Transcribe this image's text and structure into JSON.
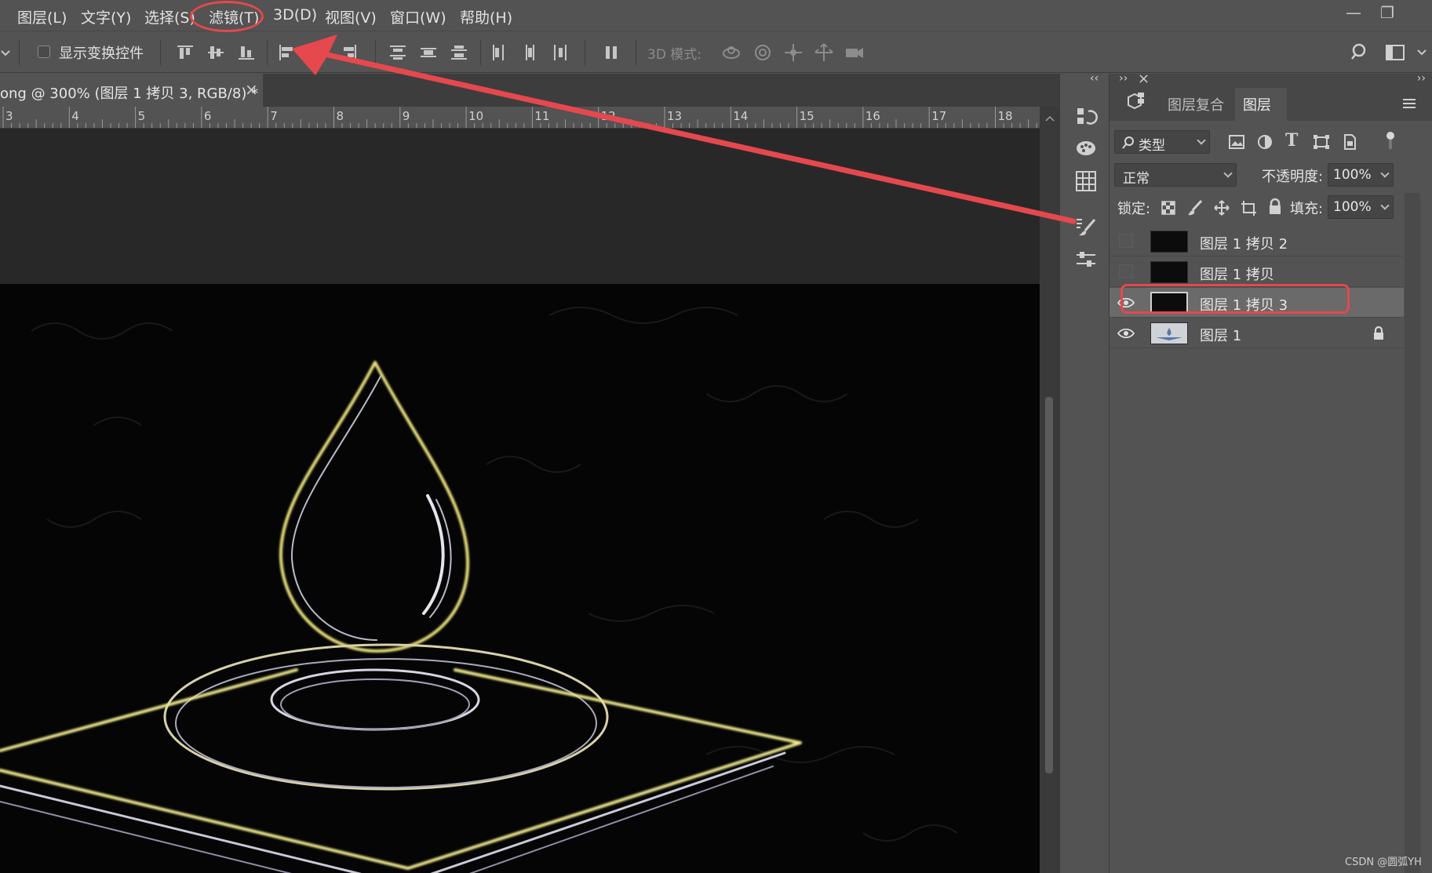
{
  "menu": {
    "items": [
      "图层(L)",
      "文字(Y)",
      "选择(S)",
      "滤镜(T)",
      "3D(D)",
      "视图(V)",
      "窗口(W)",
      "帮助(H)"
    ],
    "highlighted": "滤镜(T)"
  },
  "window_controls": {
    "minimize": "—",
    "restore": "❐"
  },
  "options_bar": {
    "show_transform_label": "显示变换控件",
    "show_transform_checked": false,
    "mode_3d_label": "3D 模式:"
  },
  "document": {
    "tab_title": "ong @ 300% (图层 1 拷贝 3, RGB/8) *",
    "close": "×"
  },
  "ruler": {
    "ticks": [
      "3",
      "4",
      "5",
      "6",
      "7",
      "8",
      "9",
      "10",
      "11",
      "12",
      "13",
      "14",
      "15",
      "16",
      "17",
      "18"
    ]
  },
  "dock": {
    "collapse_left": "‹‹",
    "collapse_right": "››",
    "close": "×"
  },
  "layers_panel": {
    "tabs": [
      "图层复合",
      "图层"
    ],
    "active_tab": "图层",
    "filter_kind": "类型",
    "blend_mode": "正常",
    "opacity_label": "不透明度:",
    "opacity_value": "100%",
    "lock_label": "锁定:",
    "fill_label": "填充:",
    "fill_value": "100%",
    "layers": [
      {
        "name": "图层 1 拷贝 2",
        "visible": false,
        "selected": false,
        "locked": false
      },
      {
        "name": "图层 1 拷贝",
        "visible": false,
        "selected": false,
        "locked": false
      },
      {
        "name": "图层 1 拷贝 3",
        "visible": true,
        "selected": true,
        "locked": false
      },
      {
        "name": "图层 1",
        "visible": true,
        "selected": false,
        "locked": true
      }
    ]
  },
  "annotation": {
    "color": "#e5484d"
  },
  "watermark": "CSDN @圆弧YH"
}
